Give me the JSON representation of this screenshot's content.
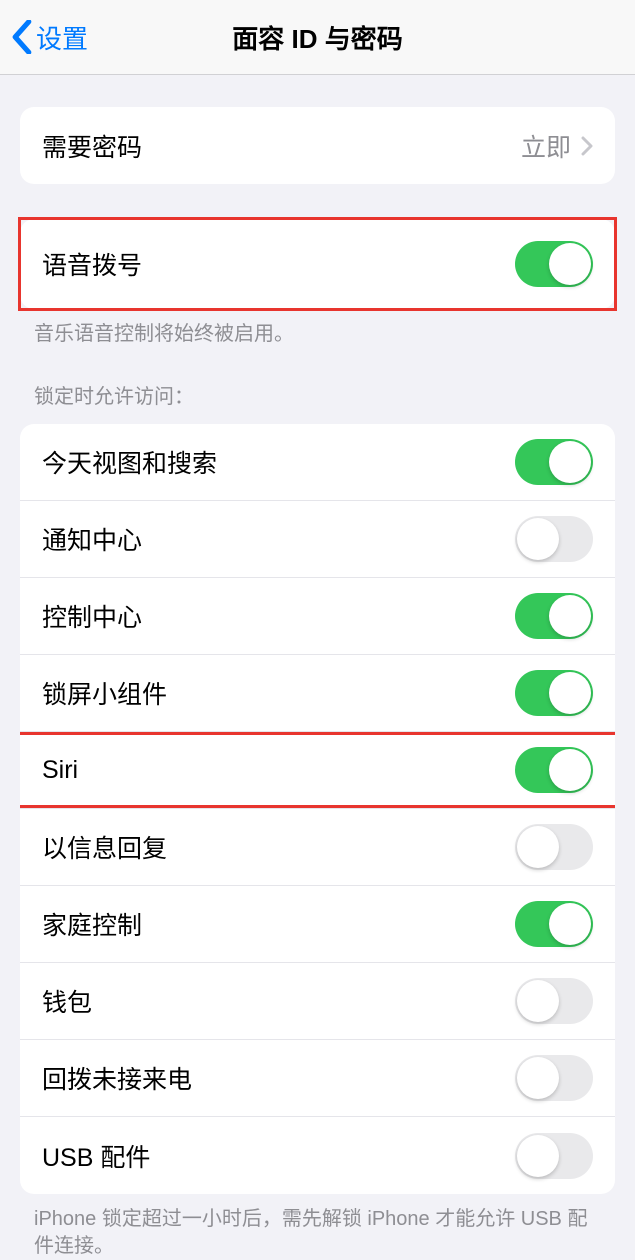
{
  "nav": {
    "back_label": "设置",
    "title": "面容 ID 与密码"
  },
  "passcode": {
    "require_label": "需要密码",
    "require_value": "立即"
  },
  "voice_dial": {
    "label": "语音拨号",
    "on": true,
    "footer": "音乐语音控制将始终被启用。"
  },
  "lock_access": {
    "header": "锁定时允许访问：",
    "items": [
      {
        "label": "今天视图和搜索",
        "on": true
      },
      {
        "label": "通知中心",
        "on": false
      },
      {
        "label": "控制中心",
        "on": true
      },
      {
        "label": "锁屏小组件",
        "on": true
      },
      {
        "label": "Siri",
        "on": true
      },
      {
        "label": "以信息回复",
        "on": false
      },
      {
        "label": "家庭控制",
        "on": true
      },
      {
        "label": "钱包",
        "on": false
      },
      {
        "label": "回拨未接来电",
        "on": false
      },
      {
        "label": "USB 配件",
        "on": false
      }
    ],
    "footer": "iPhone 锁定超过一小时后，需先解锁 iPhone 才能允许 USB 配件连接。"
  },
  "highlighted_rows": [
    "语音拨号",
    "Siri"
  ]
}
